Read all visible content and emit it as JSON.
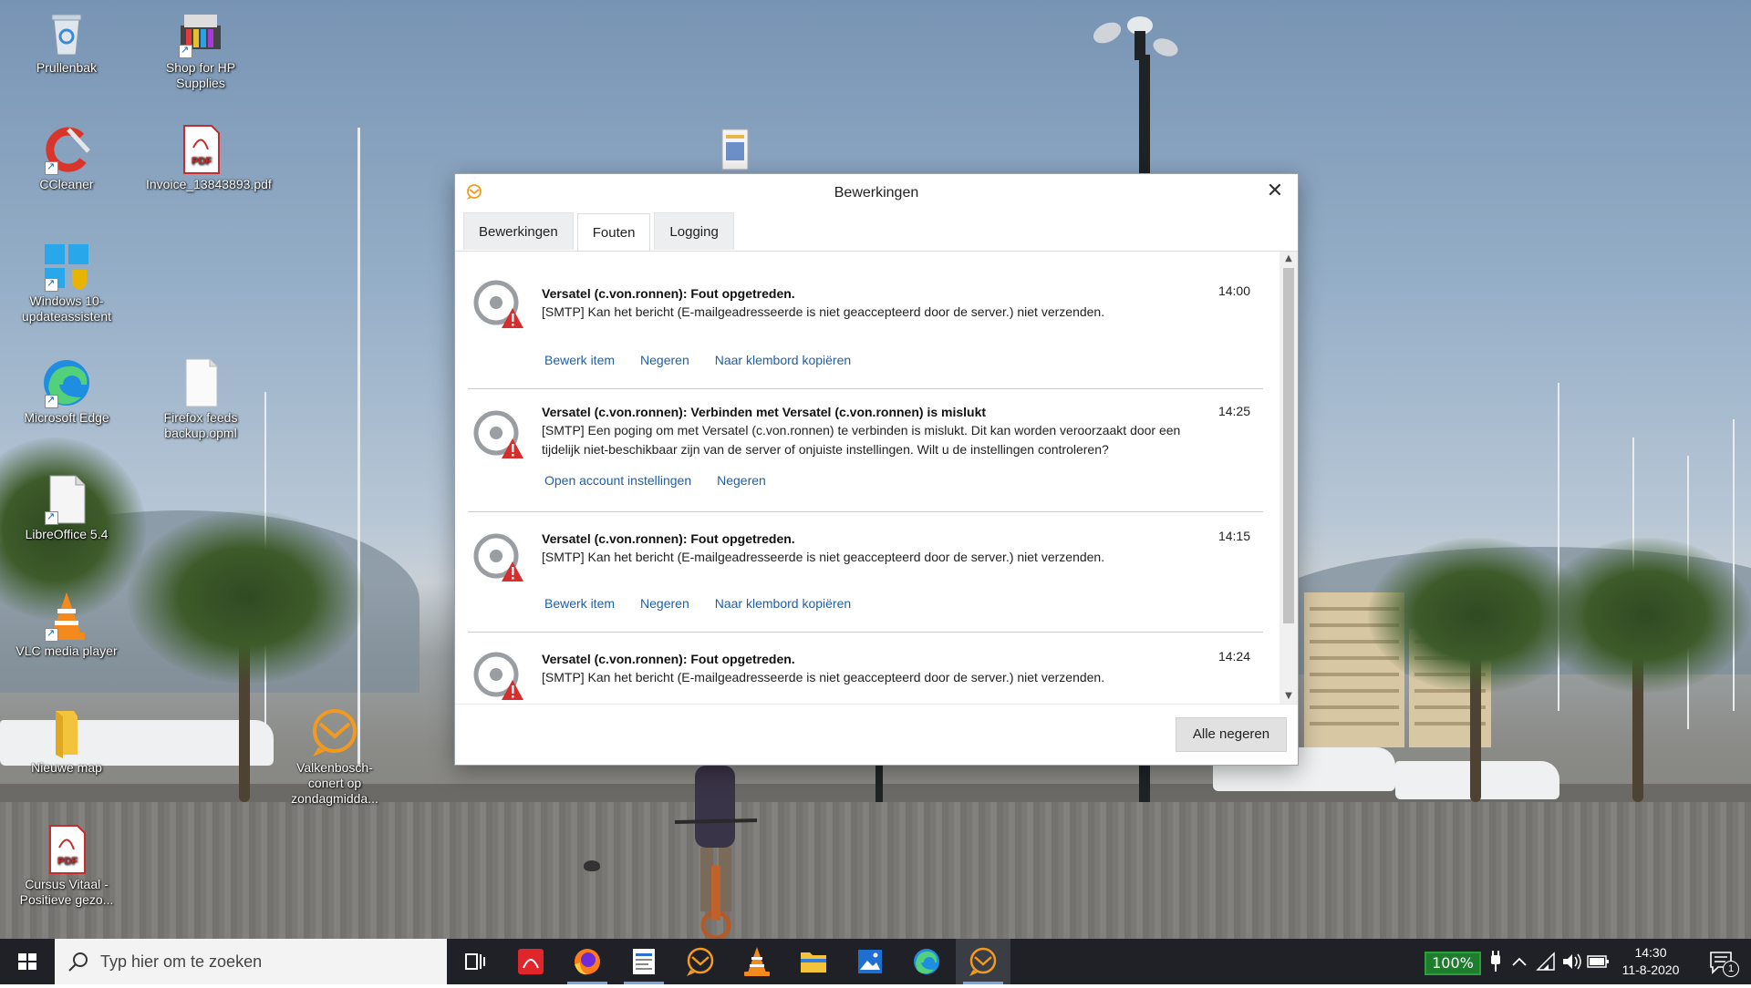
{
  "desktop": {
    "icons": [
      {
        "label": "Prullenbak",
        "icon": "recycle-bin-icon"
      },
      {
        "label": "Shop for HP Supplies",
        "icon": "printer-icon"
      },
      {
        "label": "CCleaner",
        "icon": "ccleaner-icon"
      },
      {
        "label": "Invoice_13843893.pdf",
        "icon": "pdf-icon"
      },
      {
        "label": "Windows 10-updateassistent",
        "icon": "windows-icon"
      },
      {
        "label": "Microsoft Edge",
        "icon": "edge-icon"
      },
      {
        "label": "Firefox feeds backup.opml",
        "icon": "file-icon"
      },
      {
        "label": "LibreOffice 5.4",
        "icon": "libreoffice-icon"
      },
      {
        "label": "VLC media player",
        "icon": "vlc-icon"
      },
      {
        "label": "Nieuwe map",
        "icon": "folder-icon"
      },
      {
        "label": "Valkenbosch-conert op zondagmidda...",
        "icon": "emclient-icon"
      },
      {
        "label": "Cursus Vitaal - Positieve gezo...",
        "icon": "pdf-icon"
      }
    ]
  },
  "dialog": {
    "title": "Bewerkingen",
    "close_icon": "close-icon",
    "tabs": [
      {
        "label": "Bewerkingen",
        "active": false
      },
      {
        "label": "Fouten",
        "active": true
      },
      {
        "label": "Logging",
        "active": false
      }
    ],
    "errors": [
      {
        "subject": "Versatel (c.von.ronnen): Fout opgetreden.",
        "message": "[SMTP] Kan het bericht (E-mailgeadresseerde is niet geaccepteerd door de server.) niet verzenden.",
        "time": "14:00",
        "actions": [
          "Bewerk item",
          "Negeren",
          "Naar klembord kopiëren"
        ]
      },
      {
        "subject": "Versatel (c.von.ronnen): Verbinden met Versatel (c.von.ronnen) is mislukt",
        "message": "[SMTP] Een poging om met Versatel (c.von.ronnen) te verbinden is mislukt. Dit kan worden veroorzaakt door een tijdelijk niet-beschikbaar zijn van de server of onjuiste instellingen. Wilt u de instellingen controleren?",
        "time": "14:25",
        "actions": [
          "Open account instellingen",
          "Negeren"
        ]
      },
      {
        "subject": "Versatel (c.von.ronnen): Fout opgetreden.",
        "message": "[SMTP] Kan het bericht (E-mailgeadresseerde is niet geaccepteerd door de server.) niet verzenden.",
        "time": "14:15",
        "actions": [
          "Bewerk item",
          "Negeren",
          "Naar klembord kopiëren"
        ]
      },
      {
        "subject": "Versatel (c.von.ronnen): Fout opgetreden.",
        "message": "[SMTP] Kan het bericht (E-mailgeadresseerde is niet geaccepteerd door de server.) niet verzenden.",
        "time": "14:24",
        "actions": []
      }
    ],
    "ignore_all_label": "Alle negeren"
  },
  "taskbar": {
    "search_placeholder": "Typ hier om te zoeken",
    "apps": [
      "task-view-icon",
      "acrobat-icon",
      "firefox-icon",
      "wordpad-icon",
      "emclient-icon",
      "vlc-icon",
      "file-explorer-icon",
      "photos-icon",
      "edge-icon",
      "emclient-icon"
    ],
    "battery_percent": "100%",
    "time": "14:30",
    "date": "11-8-2020",
    "notification_count": "1"
  },
  "colors": {
    "link": "#1f5fa8",
    "taskbar_bg": "#1f2126",
    "battery_green": "#1e7d2d",
    "error_red": "#d32f2f",
    "emclient_orange": "#f29a20"
  }
}
